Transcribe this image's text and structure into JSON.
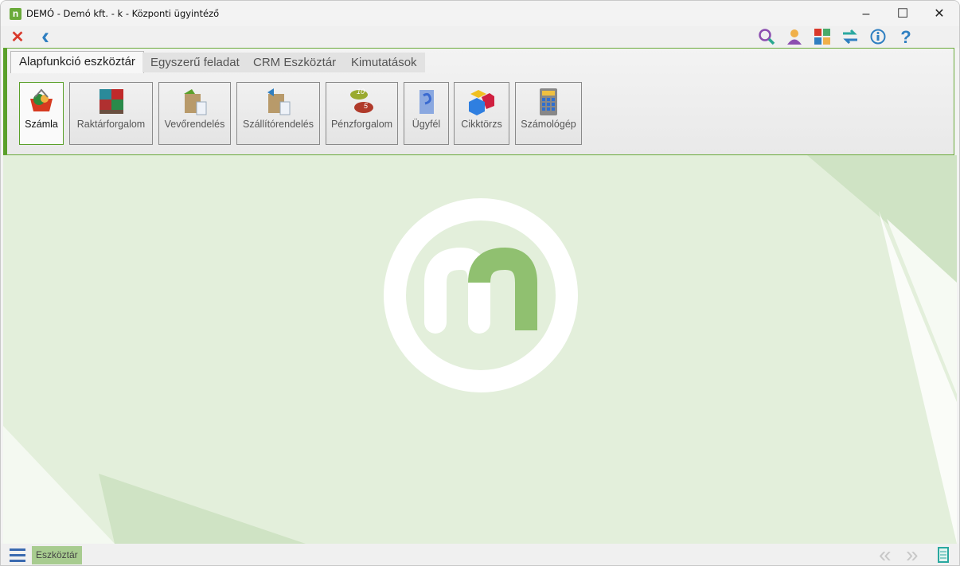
{
  "window": {
    "title": "DEMÓ - Demó kft. - k - Központi ügyintéző",
    "app_icon": "n",
    "minimize": "–",
    "maximize": "☐",
    "close": "✕"
  },
  "toolbar": {
    "left": [
      {
        "icon": "close-icon",
        "glyph": "✕",
        "color": "#d9392b"
      },
      {
        "icon": "back-icon",
        "glyph": "‹",
        "color": "#2f7fc1"
      }
    ],
    "right": [
      {
        "icon": "search-icon"
      },
      {
        "icon": "user-icon"
      },
      {
        "icon": "tiles-icon"
      },
      {
        "icon": "swap-icon"
      },
      {
        "icon": "info-icon"
      },
      {
        "icon": "help-icon",
        "glyph": "?"
      }
    ]
  },
  "tabs": [
    {
      "label": "Alapfunkció eszköztár",
      "active": true
    },
    {
      "label": "Egyszerű feladat"
    },
    {
      "label": "CRM Eszköztár"
    },
    {
      "label": "Kimutatások"
    }
  ],
  "buttons": [
    {
      "label": "Számla",
      "active": true
    },
    {
      "label": "Raktárforgalom"
    },
    {
      "label": "Vevőrendelés"
    },
    {
      "label": "Szállítórendelés"
    },
    {
      "label": "Pénzforgalom",
      "coin1": "10",
      "coin2": "5"
    },
    {
      "label": "Ügyfél"
    },
    {
      "label": "Cikktörzs"
    },
    {
      "label": "Számológép"
    }
  ],
  "statusbar": {
    "tab_label": "Eszköztár",
    "prev": "«",
    "next": "»"
  },
  "colors": {
    "accent": "#5aa02a",
    "background": "#e3efdb"
  }
}
